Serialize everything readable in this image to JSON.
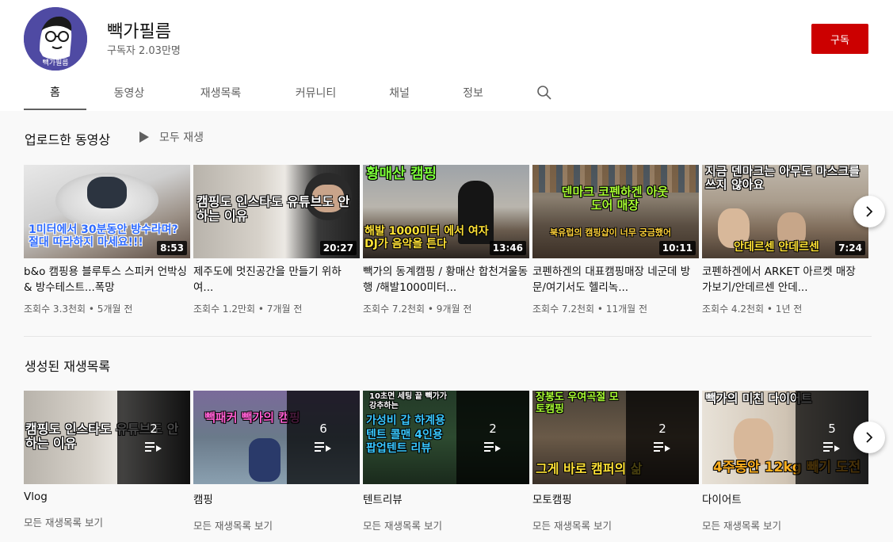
{
  "channel": {
    "name": "빽가필름",
    "subscribers": "구독자 2.03만명",
    "avatar_text": "빽가필름",
    "subscribe_label": "구독"
  },
  "tabs": [
    {
      "label": "홈",
      "active": true
    },
    {
      "label": "동영상"
    },
    {
      "label": "재생목록"
    },
    {
      "label": "커뮤니티"
    },
    {
      "label": "채널"
    },
    {
      "label": "정보"
    }
  ],
  "uploads": {
    "title": "업로드한 동영상",
    "play_all": "모두 재생",
    "videos": [
      {
        "title": "b&o 캠핑용 블루투스 스피커 언박싱 & 방수테스트...폭망",
        "meta": "조회수 3.3천회 • 5개월 전",
        "duration": "8:53",
        "thumb_text": "1미터에서 30분동안 방수라며? 절대 따라하지 마세요!!!"
      },
      {
        "title": "제주도에 멋진공간을 만들기 위하여...",
        "meta": "조회수 1.2만회 • 7개월 전",
        "duration": "20:27",
        "thumb_text": "캠핑도 인스타도 유튜브도 안하는 이유"
      },
      {
        "title": "빽가의 동계캠핑 / 황매산 합천겨울동행 /해발1000미터...",
        "meta": "조회수 7.2천회 • 9개월 전",
        "duration": "13:46",
        "thumb_text_top": "황매산 캠핑",
        "thumb_text": "해발 1000미터 에서 여자DJ가 음악을 튼다"
      },
      {
        "title": "코펜하겐의 대표캠핑매장 네군데 방문/여기서도 헬리녹...",
        "meta": "조회수 7.2천회 • 11개월 전",
        "duration": "10:11",
        "thumb_text_top": "덴마크 코펜하겐 아웃도어 매장",
        "thumb_text": "북유럽의 캠핑샵이 너무 궁금했어"
      },
      {
        "title": "코펜하겐에서 ARKET 아르켓 매장 가보기/안데르센 안데...",
        "meta": "조회수 4.2천회 • 1년 전",
        "duration": "7:24",
        "thumb_text_top": "지금 덴마크는 아무도 마스크를 쓰지 않아요",
        "thumb_text": "안데르센 안데르센"
      }
    ]
  },
  "playlists": {
    "title": "생성된 재생목록",
    "items": [
      {
        "title": "Vlog",
        "count": "2",
        "link": "모든 재생목록 보기",
        "thumb_text": "캠핑도 인스타도 유튜브도 안하는 이유"
      },
      {
        "title": "캠핑",
        "count": "6",
        "link": "모든 재생목록 보기",
        "thumb_text": "빽패커 빽가의 캠핑"
      },
      {
        "title": "텐트리뷰",
        "count": "2",
        "link": "모든 재생목록 보기",
        "thumb_text_top": "10초면 세팅 끝 빽가가 강추하는",
        "thumb_text": "가성비 갑 하계용 텐트 콜맨 4인용 팝업텐트 리뷰"
      },
      {
        "title": "모토캠핑",
        "count": "2",
        "link": "모든 재생목록 보기",
        "thumb_text_top": "장봉도 우여곡절 모토캠핑",
        "thumb_text": "그게 바로 캠퍼의 삶"
      },
      {
        "title": "다이어트",
        "count": "5",
        "link": "모든 재생목록 보기",
        "thumb_text_top": "빽가의 미친 다이어트",
        "thumb_text": "4주동안 12kg 빼기 도전"
      }
    ]
  }
}
